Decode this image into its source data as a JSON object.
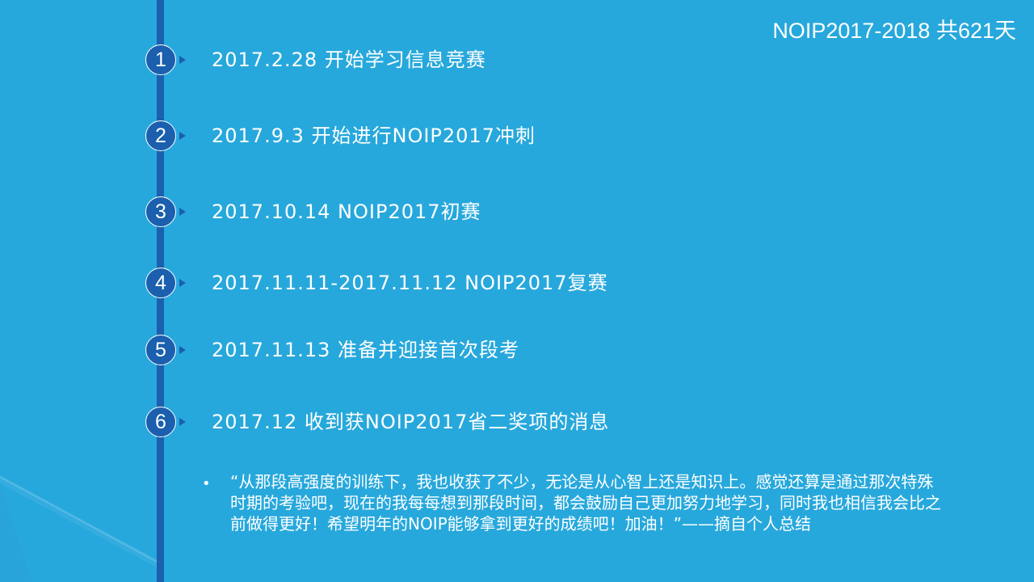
{
  "header": {
    "title": "NOIP2017-2018 共621天"
  },
  "milestones": [
    {
      "number": "1",
      "text": "2017.2.28 开始学习信息竞赛"
    },
    {
      "number": "2",
      "text": "2017.9.3 开始进行NOIP2017冲刺"
    },
    {
      "number": "3",
      "text": "2017.10.14 NOIP2017初赛"
    },
    {
      "number": "4",
      "text": "2017.11.11-2017.11.12 NOIP2017复赛"
    },
    {
      "number": "5",
      "text": "2017.11.13 准备并迎接首次段考"
    },
    {
      "number": "6",
      "text": "2017.12 收到获NOIP2017省二奖项的消息"
    }
  ],
  "quote": {
    "bullet": "•",
    "text": "“从那段高强度的训练下，我也收获了不少，无论是从心智上还是知识上。感觉还算是通过那次特殊时期的考验吧，现在的我每每想到那段时间，都会鼓励自己更加努力地学习，同时我也相信我会比之前做得更好！希望明年的NOIP能够拿到更好的成绩吧！加油！”——摘自个人总结"
  },
  "colors": {
    "background": "#27a8dc",
    "timeline": "#1b5fae",
    "text": "#ffffff"
  }
}
